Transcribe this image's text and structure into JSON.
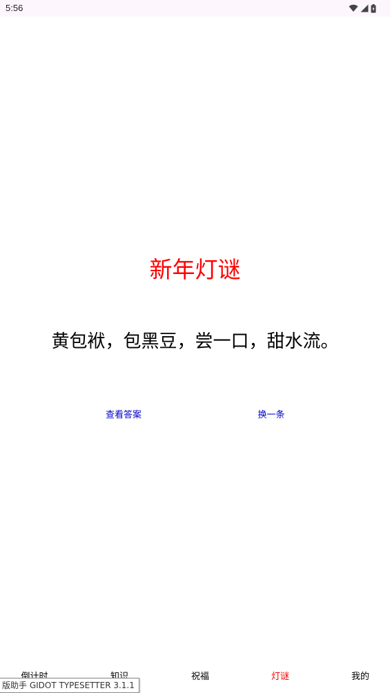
{
  "status_bar": {
    "time": "5:56",
    "icons": [
      "wifi-icon",
      "signal-icon",
      "battery-icon"
    ]
  },
  "riddle": {
    "title": "新年灯谜",
    "question": "黄包袱，包黑豆，尝一口，甜水流。"
  },
  "actions": {
    "show_answer": "查看答案",
    "next": "换一条"
  },
  "tab_bar": {
    "tabs": [
      {
        "label": "倒计时",
        "active": false
      },
      {
        "label": "知识",
        "active": false
      },
      {
        "label": "祝福",
        "active": false
      },
      {
        "label": "灯谜",
        "active": true
      },
      {
        "label": "我的",
        "active": false
      }
    ]
  },
  "overlay": {
    "watermark_text": "版助手 GIDOT TYPESETTER 3.1.1"
  },
  "colors": {
    "title": "#ff0000",
    "link": "#0000cc",
    "active_tab": "#ff0000",
    "text": "#000000"
  }
}
